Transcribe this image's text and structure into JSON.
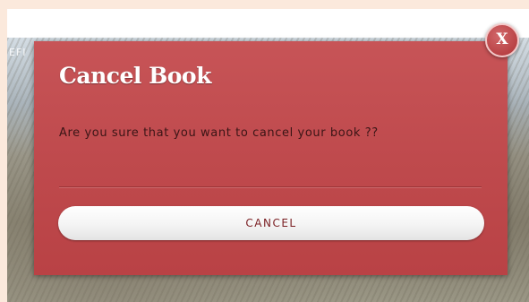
{
  "background": {
    "partial_label": "EFI"
  },
  "modal": {
    "title": "Cancel Book",
    "message": "Are you sure that you want to cancel your book ??",
    "cancel_label": "CANCEL",
    "close_label": "X",
    "colors": {
      "panel": "#bf4a4d",
      "title_text": "#ffffff",
      "message_text": "#3a1516",
      "button_text": "#7a1e22"
    }
  }
}
